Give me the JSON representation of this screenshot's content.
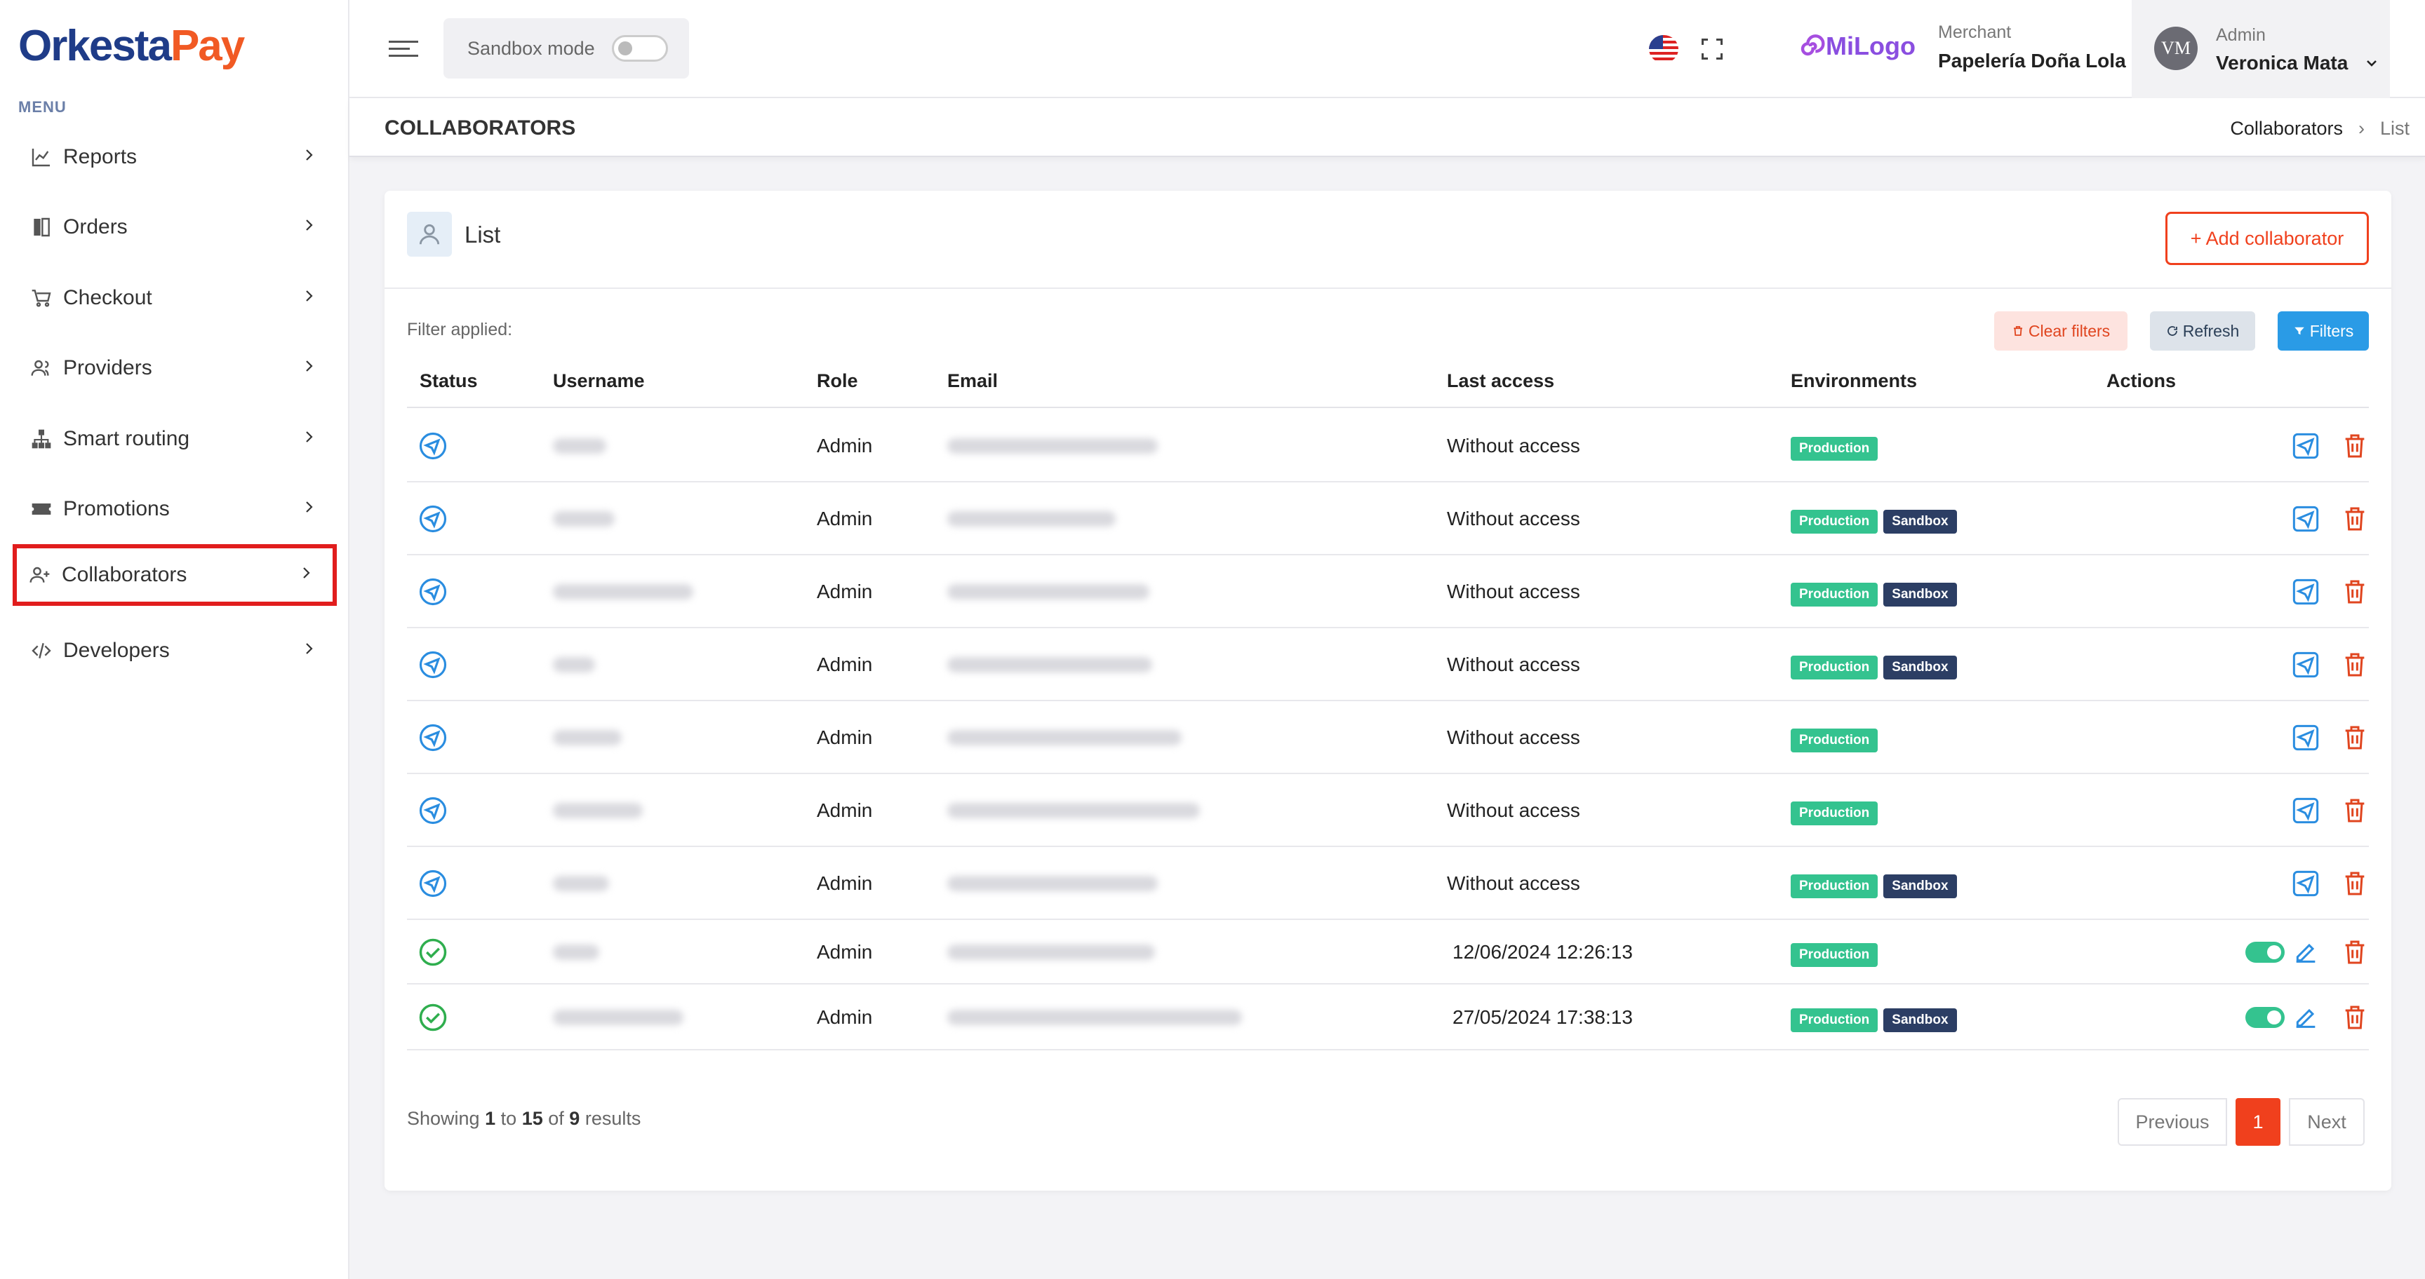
{
  "brand": {
    "name_part1": "Orkesta",
    "name_part2": "Pay"
  },
  "sidebar": {
    "menu_title": "MENU",
    "items": [
      {
        "label": "Reports",
        "icon": "chart-line-icon"
      },
      {
        "label": "Orders",
        "icon": "book-icon"
      },
      {
        "label": "Checkout",
        "icon": "cart-icon"
      },
      {
        "label": "Providers",
        "icon": "users-icon"
      },
      {
        "label": "Smart routing",
        "icon": "sitemap-icon"
      },
      {
        "label": "Promotions",
        "icon": "ticket-icon"
      },
      {
        "label": "Collaborators",
        "icon": "user-plus-icon",
        "active": true
      },
      {
        "label": "Developers",
        "icon": "code-icon"
      }
    ]
  },
  "topbar": {
    "sandbox_label": "Sandbox mode",
    "sandbox_on": false,
    "merchant_logo": "MiLogo",
    "merchant_key": "Merchant",
    "merchant_name": "Papelería Doña Lola",
    "user_initials": "VM",
    "user_role": "Admin",
    "user_name": "Veronica Mata"
  },
  "page": {
    "title": "COLLABORATORS",
    "breadcrumb": [
      "Collaborators",
      "List"
    ]
  },
  "card": {
    "title": "List",
    "add_button": "+ Add collaborator",
    "filter_label": "Filter applied:",
    "clear_filters": "Clear filters",
    "refresh": "Refresh",
    "filters": "Filters"
  },
  "table": {
    "columns": [
      "Status",
      "Username",
      "Role",
      "Email",
      "Last access",
      "Environments",
      "Actions"
    ],
    "rows": [
      {
        "status": "invited",
        "role": "Admin",
        "last_access": "Without access",
        "envs": [
          "Production"
        ]
      },
      {
        "status": "invited",
        "role": "Admin",
        "last_access": "Without access",
        "envs": [
          "Production",
          "Sandbox"
        ]
      },
      {
        "status": "invited",
        "role": "Admin",
        "last_access": "Without access",
        "envs": [
          "Production",
          "Sandbox"
        ]
      },
      {
        "status": "invited",
        "role": "Admin",
        "last_access": "Without access",
        "envs": [
          "Production",
          "Sandbox"
        ]
      },
      {
        "status": "invited",
        "role": "Admin",
        "last_access": "Without access",
        "envs": [
          "Production"
        ]
      },
      {
        "status": "invited",
        "role": "Admin",
        "last_access": "Without access",
        "envs": [
          "Production"
        ]
      },
      {
        "status": "invited",
        "role": "Admin",
        "last_access": "Without access",
        "envs": [
          "Production",
          "Sandbox"
        ]
      },
      {
        "status": "active",
        "role": "Admin",
        "last_access": "12/06/2024 12:26:13",
        "envs": [
          "Production"
        ]
      },
      {
        "status": "active",
        "role": "Admin",
        "last_access": "27/05/2024 17:38:13",
        "envs": [
          "Production",
          "Sandbox"
        ]
      }
    ]
  },
  "footer": {
    "showing_prefix": "Showing",
    "from": "1",
    "to_word": "to",
    "to": "15",
    "of_word": "of",
    "total": "9",
    "results_word": "results",
    "previous": "Previous",
    "current_page": "1",
    "next": "Next"
  },
  "colors": {
    "brand_blue": "#1f3c88",
    "brand_orange": "#f15a24",
    "accent": "#f0401d",
    "production": "#34c38f",
    "sandbox": "#2c3e64",
    "active_outline": "#e11d1d"
  }
}
